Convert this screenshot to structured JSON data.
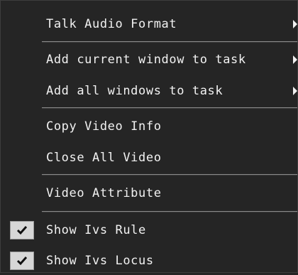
{
  "menu": {
    "items": [
      {
        "label": "Talk Audio Format",
        "submenu": true
      },
      {
        "label": "Add current window to task",
        "submenu": true
      },
      {
        "label": "Add all windows to task",
        "submenu": true
      },
      {
        "label": "Copy Video Info"
      },
      {
        "label": "Close All Video"
      },
      {
        "label": "Video Attribute"
      },
      {
        "label": "Show Ivs Rule",
        "checked": true
      },
      {
        "label": "Show Ivs Locus",
        "checked": true
      }
    ]
  },
  "icons": {
    "submenu": "chevron-right-icon",
    "check": "checkmark-icon"
  },
  "colors": {
    "background": "#252525",
    "text": "#f2f2f2",
    "separator": "#8a8a8a",
    "check_box": "#d7d7d7"
  }
}
